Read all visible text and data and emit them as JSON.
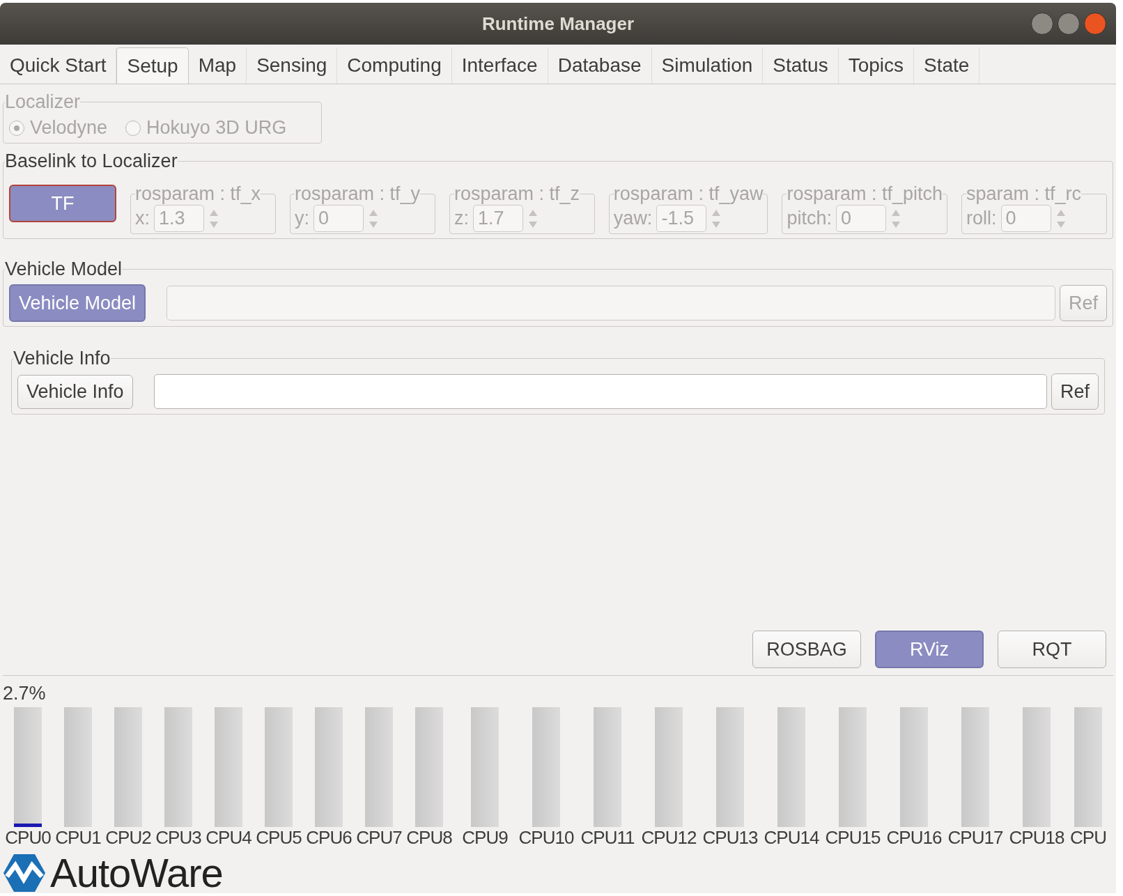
{
  "window": {
    "title": "Runtime Manager"
  },
  "tabs": [
    {
      "label": "Quick Start",
      "selected": false
    },
    {
      "label": "Setup",
      "selected": true
    },
    {
      "label": "Map",
      "selected": false
    },
    {
      "label": "Sensing",
      "selected": false
    },
    {
      "label": "Computing",
      "selected": false
    },
    {
      "label": "Interface",
      "selected": false
    },
    {
      "label": "Database",
      "selected": false
    },
    {
      "label": "Simulation",
      "selected": false
    },
    {
      "label": "Status",
      "selected": false
    },
    {
      "label": "Topics",
      "selected": false
    },
    {
      "label": "State",
      "selected": false
    }
  ],
  "localizer": {
    "title": "Localizer",
    "disabled": true,
    "options": [
      {
        "label": "Velodyne",
        "selected": true
      },
      {
        "label": "Hokuyo 3D URG",
        "selected": false
      }
    ]
  },
  "baselink": {
    "title": "Baselink to Localizer",
    "button": {
      "label": "TF",
      "on": true
    },
    "params": [
      {
        "title": "rosparam : tf_x",
        "label": "x:",
        "value": "1.3"
      },
      {
        "title": "rosparam : tf_y",
        "label": "y:",
        "value": "0"
      },
      {
        "title": "rosparam : tf_z",
        "label": "z:",
        "value": "1.7"
      },
      {
        "title": "rosparam : tf_yaw",
        "label": "yaw:",
        "value": "-1.5"
      },
      {
        "title": "rosparam : tf_pitch",
        "label": "pitch:",
        "value": "0"
      },
      {
        "title": "sparam : tf_rc",
        "label": "roll:",
        "value": "0"
      }
    ]
  },
  "vehicle_model": {
    "title": "Vehicle Model",
    "button": {
      "label": "Vehicle Model",
      "on": true
    },
    "ref": {
      "label": "Ref",
      "disabled": true
    }
  },
  "vehicle_info": {
    "title": "Vehicle Info",
    "button": {
      "label": "Vehicle Info",
      "on": false
    },
    "ref": {
      "label": "Ref",
      "disabled": false
    }
  },
  "tools": [
    {
      "label": "ROSBAG",
      "on": false
    },
    {
      "label": "RViz",
      "on": true
    },
    {
      "label": "RQT",
      "on": false
    }
  ],
  "cpu": {
    "reading": "2.7%",
    "bars": [
      {
        "label": "CPU0",
        "level": 0.027
      },
      {
        "label": "CPU1"
      },
      {
        "label": "CPU2"
      },
      {
        "label": "CPU3"
      },
      {
        "label": "CPU4"
      },
      {
        "label": "CPU5"
      },
      {
        "label": "CPU6"
      },
      {
        "label": "CPU7"
      },
      {
        "label": "CPU8"
      },
      {
        "label": "CPU9"
      },
      {
        "label": "CPU10"
      },
      {
        "label": "CPU11"
      },
      {
        "label": "CPU12"
      },
      {
        "label": "CPU13"
      },
      {
        "label": "CPU14"
      },
      {
        "label": "CPU15"
      },
      {
        "label": "CPU16"
      },
      {
        "label": "CPU17"
      },
      {
        "label": "CPU18"
      },
      {
        "label": "CPU"
      }
    ]
  },
  "logo": {
    "text": "AutoWare"
  }
}
